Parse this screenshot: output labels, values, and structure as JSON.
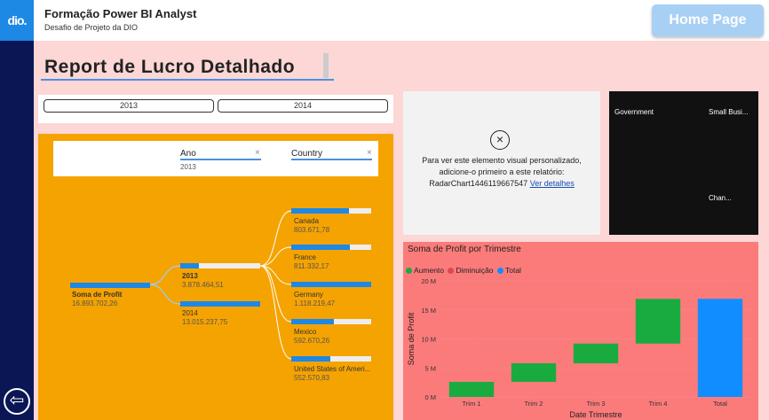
{
  "app": {
    "logo_text": "dio.",
    "title": "Formação Power BI Analyst",
    "subtitle": "Desafio de Projeto da DIO",
    "home_button": "Home Page",
    "back_icon": "arrow-left-circle-icon"
  },
  "report": {
    "title": "Report de Lucro Detalhado"
  },
  "year_slicer": {
    "options": [
      "2013",
      "2014"
    ]
  },
  "decomp": {
    "filters": [
      {
        "label": "Ano",
        "value": "2013"
      },
      {
        "label": "Country",
        "value": ""
      }
    ],
    "root": {
      "label": "Soma de Profit",
      "value": "16.893.702,26"
    },
    "years": [
      {
        "label": "2013",
        "value": "3.878.464,51"
      },
      {
        "label": "2014",
        "value": "13.015.237,75"
      }
    ],
    "countries": [
      {
        "label": "Canada",
        "value": "803.671,78",
        "fill": 0.72
      },
      {
        "label": "France",
        "value": "811.332,17",
        "fill": 0.73
      },
      {
        "label": "Germany",
        "value": "1.118.219,47",
        "fill": 1.0
      },
      {
        "label": "Mexico",
        "value": "592.670,26",
        "fill": 0.53
      },
      {
        "label": "United States of Ameri...",
        "value": "552.570,83",
        "fill": 0.49
      }
    ]
  },
  "radar": {
    "message": "Para ver este elemento visual personalizado, adicione-o primeiro a este relatório: RadarChart1446119667547",
    "link": "Ver detalhes"
  },
  "treemap": {
    "tiles": [
      {
        "label": "Government",
        "color": "#1e88ff"
      },
      {
        "label": "Small Busi...",
        "color": "#1a1e9e"
      },
      {
        "label": "Chan...",
        "color": "#e66c37"
      },
      {
        "label": "",
        "color": "#6b007b"
      }
    ]
  },
  "chart_data": {
    "type": "bar",
    "title": "Soma de Profit por Trimestre",
    "xlabel": "Date Trimestre",
    "ylabel": "Soma de Profit",
    "legend": [
      "Aumento",
      "Diminuição",
      "Total"
    ],
    "legend_colors": [
      "#1aab40",
      "#e04650",
      "#118dff"
    ],
    "categories": [
      "Trim 1",
      "Trim 2",
      "Trim 3",
      "Trim 4",
      "Total"
    ],
    "waterfall": [
      {
        "category": "Trim 1",
        "start": 0,
        "end": 2.6,
        "kind": "Aumento"
      },
      {
        "category": "Trim 2",
        "start": 2.6,
        "end": 5.8,
        "kind": "Aumento"
      },
      {
        "category": "Trim 3",
        "start": 5.8,
        "end": 9.2,
        "kind": "Aumento"
      },
      {
        "category": "Trim 4",
        "start": 9.2,
        "end": 16.9,
        "kind": "Aumento"
      },
      {
        "category": "Total",
        "start": 0,
        "end": 16.9,
        "kind": "Total"
      }
    ],
    "yticks": [
      "0 M",
      "5 M",
      "10 M",
      "15 M",
      "20 M"
    ],
    "ylim": [
      0,
      20
    ]
  }
}
